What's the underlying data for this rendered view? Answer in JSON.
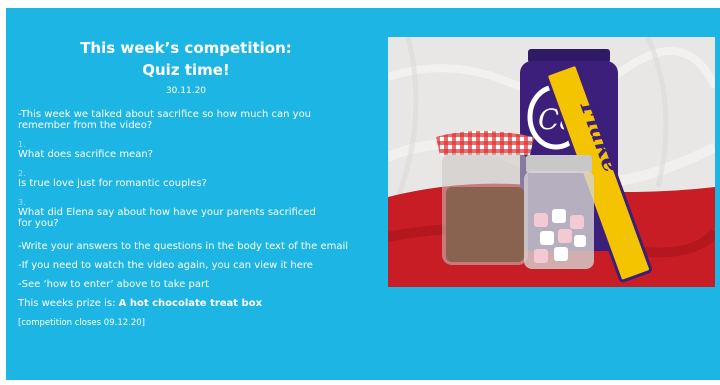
{
  "heading": {
    "line1": "This week’s competition:",
    "line2": "Quiz time!",
    "date": "30.11.20"
  },
  "intro": "-This week we talked about sacrifice so how much can you remember from the video?",
  "questions": [
    {
      "number": "1.",
      "text": "What does sacrifice mean?"
    },
    {
      "number": "2.",
      "text": "Is true love just for romantic couples?"
    },
    {
      "number": "3.",
      "text": "What did Elena say about how have your parents sacrificed for you?"
    }
  ],
  "instructions": [
    "-Write your answers to the questions in the body text of the email",
    "-If you need to watch the video again, you can view it here",
    "-See ‘how to enter’ above to take part"
  ],
  "prize": {
    "label": "This weeks prize is: ",
    "value": "A hot chocolate treat box"
  },
  "closing": "[competition closes 09.12.20]",
  "photo": {
    "flake_label": "Flake",
    "jar_label": "Cad"
  },
  "colors": {
    "background": "#1db5e4",
    "text": "#ffffff",
    "cadbury_purple": "#3b1f7a",
    "flake_yellow": "#f5c400",
    "cloth_red": "#c81d25"
  }
}
